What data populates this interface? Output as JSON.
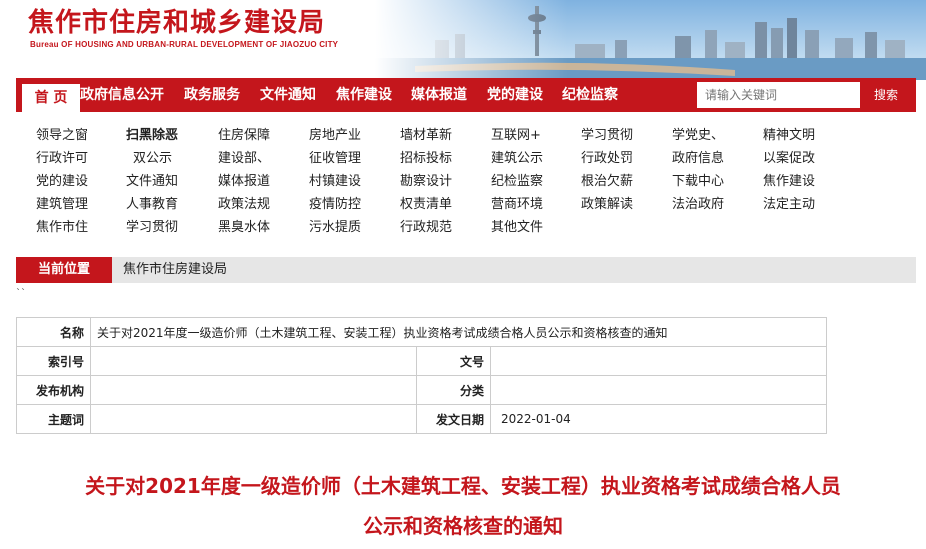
{
  "header": {
    "title_cn": "焦作市住房和城乡建设局",
    "title_en": "Bureau OF HOUSING AND URBAN-RURAL DEVELOPMENT OF JIAOZUO CITY"
  },
  "nav": {
    "items": [
      "首 页",
      "政府信息公开",
      "政务服务",
      "文件通知",
      "焦作建设",
      "媒体报道",
      "党的建设",
      "纪检监察"
    ],
    "search_placeholder": "请输入关键词",
    "search_button": "搜索"
  },
  "links": [
    [
      "领导之窗",
      "扫黑除恶",
      "住房保障",
      "房地产业",
      "墙材革新",
      "互联网+",
      "学习贯彻",
      "学党史、",
      "精神文明"
    ],
    [
      "行政许可",
      "双公示",
      "建设部、",
      "征收管理",
      "招标投标",
      "建筑公示",
      "行政处罚",
      "政府信息",
      "以案促改"
    ],
    [
      "党的建设",
      "文件通知",
      "媒体报道",
      "村镇建设",
      "勘察设计",
      "纪检监察",
      "根治欠薪",
      "下载中心",
      "焦作建设"
    ],
    [
      "建筑管理",
      "人事教育",
      "政策法规",
      "疫情防控",
      "权责清单",
      "营商环境",
      "政策解读",
      "法治政府",
      "法定主动"
    ],
    [
      "焦作市住",
      "学习贯彻",
      "黑臭水体",
      "污水提质",
      "行政规范",
      "其他文件"
    ]
  ],
  "breadcrumb": {
    "label": "当前位置",
    "link": "焦作市住房建设局"
  },
  "stray_text": "``",
  "info": {
    "name_label": "名称",
    "name_value": "关于对2021年度一级造价师（土木建筑工程、安装工程）执业资格考试成绩合格人员公示和资格核查的通知",
    "index_label": "索引号",
    "index_value": "",
    "doc_no_label": "文号",
    "doc_no_value": "",
    "publisher_label": "发布机构",
    "publisher_value": "",
    "category_label": "分类",
    "category_value": "",
    "subject_label": "主题词",
    "subject_value": "",
    "date_label": "发文日期",
    "date_value": "2022-01-04"
  },
  "article": {
    "title_line1": "关于对2021年度一级造价师（土木建筑工程、安装工程）执业资格考试成绩合格人员",
    "title_line2": "公示和资格核查的通知"
  },
  "colors": {
    "brand_red": "#c4161c",
    "breadcrumb_bg": "#e6e6e6"
  }
}
